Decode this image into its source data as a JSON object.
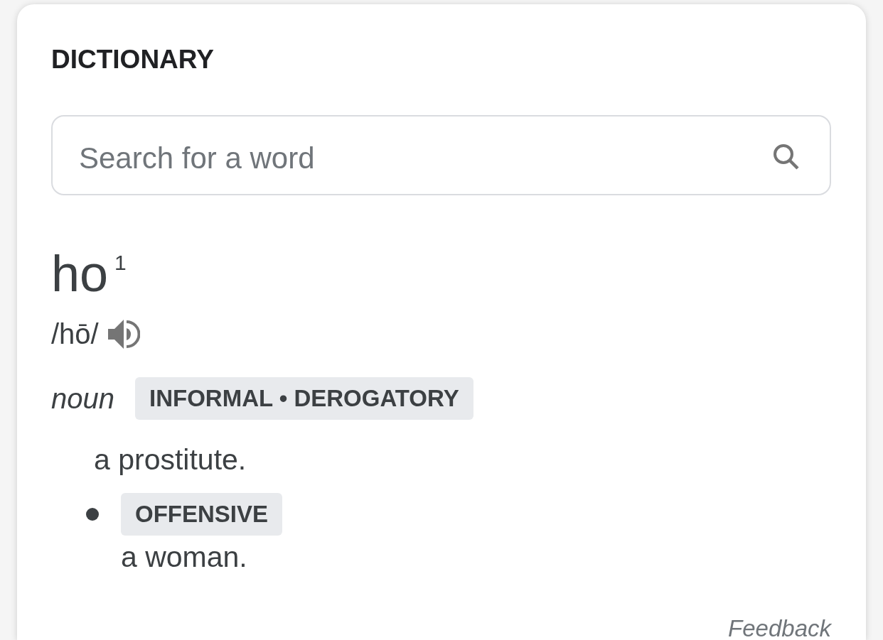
{
  "card": {
    "title": "DICTIONARY",
    "search": {
      "placeholder": "Search for a word"
    },
    "entry": {
      "headword": "ho$^{1}$",
      "pronunciation": "/hō/",
      "part_of_speech": "noun",
      "labels": [
        "INFORMAL • DEROGATORY"
      ],
      "senses": [
        {
          "definition": "a prostitute.",
          "subsenses": [
            {
              "labels": [
                "OFFENSIVE"
              ],
              "definition": "a woman."
            }
          ]
        }
      ]
    },
    "feedback": "Feedback"
  }
}
